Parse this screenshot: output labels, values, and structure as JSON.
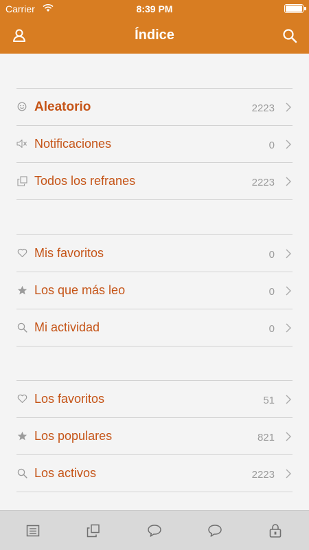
{
  "status": {
    "carrier": "Carrier",
    "time": "8:39 PM"
  },
  "navbar": {
    "title": "Índice",
    "left_icon": "user-icon",
    "right_icon": "search-icon"
  },
  "colors": {
    "header": "#d87d22",
    "accent_text": "#c55417",
    "count_text": "#9b9b9b",
    "background": "#f4f4f4",
    "tabbar": "#d9d9d9"
  },
  "sections": [
    {
      "items": [
        {
          "label": "Aleatorio",
          "count": "2223",
          "icon": "smiley-icon"
        },
        {
          "label": "Notificaciones",
          "count": "0",
          "icon": "speaker-muted-icon"
        },
        {
          "label": "Todos los refranes",
          "count": "2223",
          "icon": "copy-icon"
        }
      ]
    },
    {
      "items": [
        {
          "label": "Mis favoritos",
          "count": "0",
          "icon": "heart-icon"
        },
        {
          "label": "Los que más leo",
          "count": "0",
          "icon": "star-icon"
        },
        {
          "label": "Mi actividad",
          "count": "0",
          "icon": "search-icon"
        }
      ]
    },
    {
      "items": [
        {
          "label": "Los favoritos",
          "count": "51",
          "icon": "heart-icon"
        },
        {
          "label": "Los populares",
          "count": "821",
          "icon": "star-icon"
        },
        {
          "label": "Los activos",
          "count": "2223",
          "icon": "search-icon"
        }
      ]
    }
  ],
  "tabbar": [
    {
      "icon": "list-icon"
    },
    {
      "icon": "copy-icon"
    },
    {
      "icon": "speech-bubble-icon"
    },
    {
      "icon": "speech-bubble-icon"
    },
    {
      "icon": "lock-icon"
    }
  ]
}
